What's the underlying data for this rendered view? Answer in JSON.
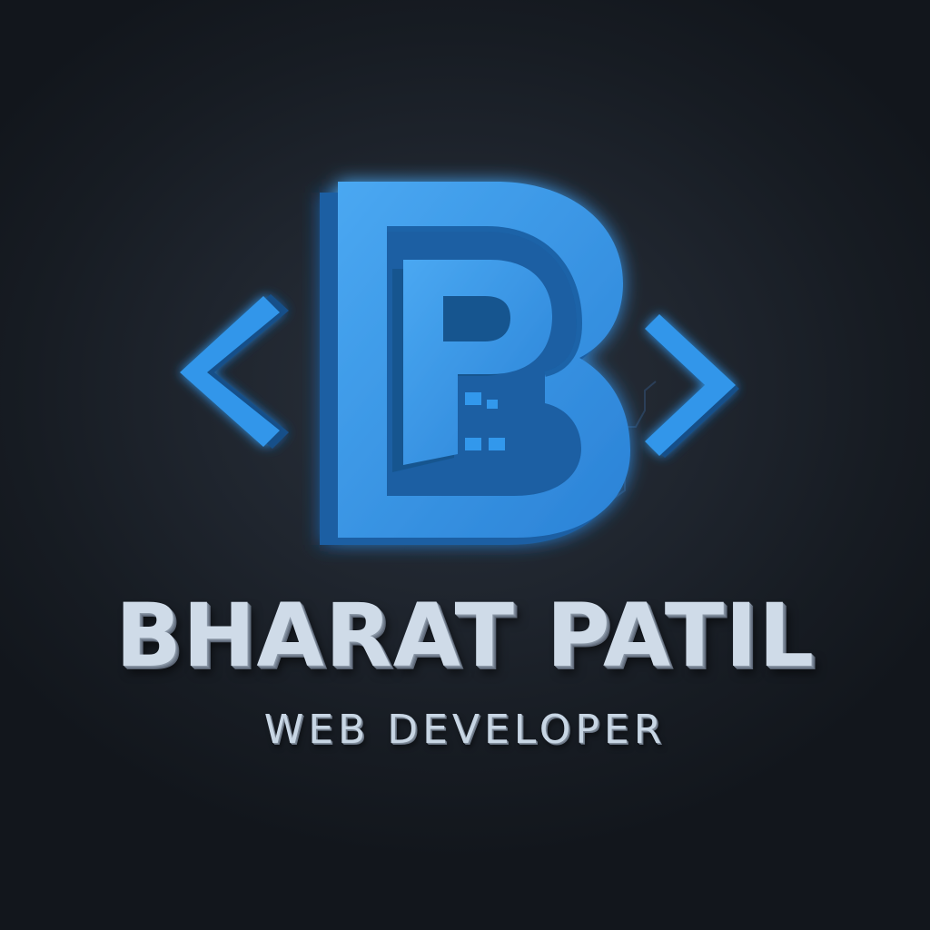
{
  "brand": {
    "name": "BHARAT PATIL",
    "tagline": "WEB DEVELOPER"
  },
  "colors": {
    "background": "#1b2028",
    "accent_blue": "#2f8fe0",
    "accent_blue_light": "#4aa8f2",
    "accent_blue_dark": "#1a5fa3",
    "text": "#cfdbe8"
  },
  "icons": {
    "left": "chevron-left-icon",
    "logo": "bp-monogram-icon",
    "right": "chevron-right-icon"
  }
}
